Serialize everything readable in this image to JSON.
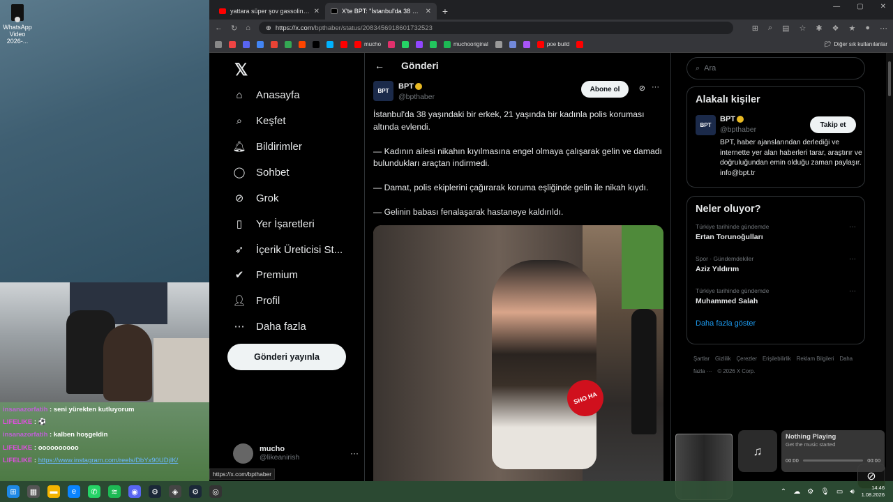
{
  "desktop": {
    "icon_label": "WhatsApp Video 2026-..."
  },
  "chat": [
    {
      "user": "insanazorfatih",
      "sep": " : ",
      "msg": "seni yürekten kutluyorum",
      "cls": "u1"
    },
    {
      "user": "LIFELIKE",
      "sep": " : ",
      "msg": "⚽",
      "cls": "u2"
    },
    {
      "user": "insanazorfatih",
      "sep": " : ",
      "msg": "kalben hoşgeldin",
      "cls": "u1"
    },
    {
      "user": "LIFELIKE",
      "sep": " : ",
      "msg": "oooooooooo",
      "cls": "u2"
    },
    {
      "user": "LIFELIKE",
      "sep": " : ",
      "msg": "https://www.instagram.com/reels/DbYx90UDjIK/",
      "cls": "u2",
      "link": true
    }
  ],
  "browser": {
    "tabs": [
      {
        "title": "yattara süper şov gassolina müziğ"
      },
      {
        "title": "X'te BPT: \"İstanbul'da 38 yaşındak"
      }
    ],
    "url_main": "https://x.com",
    "url_path": "/bpthaber/status/2083456918601732523",
    "bookmarks": [
      {
        "label": "",
        "color": "#888"
      },
      {
        "label": "",
        "color": "#e44"
      },
      {
        "label": "",
        "color": "#5865f2"
      },
      {
        "label": "",
        "color": "#4285f4"
      },
      {
        "label": "",
        "color": "#ea4335"
      },
      {
        "label": "",
        "color": "#34a853"
      },
      {
        "label": "",
        "color": "#ff4500"
      },
      {
        "label": "",
        "color": "#000"
      },
      {
        "label": "",
        "color": "#00b2ff"
      },
      {
        "label": "",
        "color": "#f00"
      },
      {
        "label": "mucho",
        "color": "#f00"
      },
      {
        "label": "",
        "color": "#e1306c"
      },
      {
        "label": "",
        "color": "#25d366"
      },
      {
        "label": "",
        "color": "#9146ff"
      },
      {
        "label": "",
        "color": "#22c55e"
      },
      {
        "label": "muchooriginal",
        "color": "#1db954"
      },
      {
        "label": "",
        "color": "#999"
      },
      {
        "label": "",
        "color": "#7289da"
      },
      {
        "label": "",
        "color": "#a855f7"
      },
      {
        "label": "poe build",
        "color": "#f00"
      },
      {
        "label": "",
        "color": "#f00"
      }
    ],
    "other_bookmarks": "Diğer sık kullanılanlar"
  },
  "nav": {
    "items": [
      {
        "label": "Anasayfa",
        "icon": "⌂",
        "name": "home"
      },
      {
        "label": "Keşfet",
        "icon": "⌕",
        "name": "explore"
      },
      {
        "label": "Bildirimler",
        "icon": "🔔︎",
        "name": "notifications"
      },
      {
        "label": "Sohbet",
        "icon": "◯",
        "name": "chat"
      },
      {
        "label": "Grok",
        "icon": "⊘",
        "name": "grok"
      },
      {
        "label": "Yer İşaretleri",
        "icon": "▯",
        "name": "bookmarks"
      },
      {
        "label": "İçerik Üreticisi St...",
        "icon": "➶",
        "name": "creator-studio"
      },
      {
        "label": "Premium",
        "icon": "✔",
        "name": "premium"
      },
      {
        "label": "Profil",
        "icon": "👤︎",
        "name": "profile"
      },
      {
        "label": "Daha fazla",
        "icon": "⋯",
        "name": "more"
      }
    ],
    "post_button": "Gönderi yayınla",
    "account_name": "mucho",
    "account_handle": "@likeanirish",
    "status_url": "https://x.com/bpthaber"
  },
  "post": {
    "header": "Gönderi",
    "author_name": "BPT",
    "author_handle": "@bpthaber",
    "avatar_text": "BPT",
    "subscribe": "Abone ol",
    "paragraphs": [
      "İstanbul'da 38 yaşındaki bir erkek, 21 yaşında bir kadınla polis koruması altında evlendi.",
      "— Kadının ailesi nikahın kıyılmasına engel olmaya çalışarak gelin ve damadı bulundukları araçtan indirmedi.",
      "— Damat, polis ekiplerini çağırarak koruma eşliğinde gelin ile nikah kıydı.",
      "— Gelinin babası fenalaşarak hastaneye kaldırıldı."
    ],
    "mic_text": "SHO HA"
  },
  "sidebar": {
    "search_placeholder": "Ara",
    "related_title": "Alakalı kişiler",
    "person_name": "BPT",
    "person_handle": "@bpthaber",
    "follow": "Takip et",
    "bio": "BPT, haber ajanslarından derlediği ve internette yer alan haberleri tarar, araştırır ve doğruluğundan emin olduğu zaman paylaşır. info@bpt.tr",
    "trends_title": "Neler oluyor?",
    "trends": [
      {
        "context": "Türkiye tarihinde gündemde",
        "name": "Ertan Torunoğulları"
      },
      {
        "context": "Spor · Gündemdekiler",
        "name": "Aziz Yıldırım"
      },
      {
        "context": "Türkiye tarihinde gündemde",
        "name": "Muhammed Salah"
      }
    ],
    "show_more": "Daha fazla göster",
    "footer": [
      "Şartlar",
      "Gizlilik",
      "Çerezler",
      "Erişilebilirlik",
      "Reklam Bilgileri",
      "Daha fazla ···",
      "© 2026 X Corp."
    ]
  },
  "music": {
    "title": "Nothing Playing",
    "subtitle": "Get the music started",
    "time_start": "00:00",
    "time_end": "00:00"
  },
  "clock": {
    "time": "14:46",
    "date": "1.08.2026"
  }
}
